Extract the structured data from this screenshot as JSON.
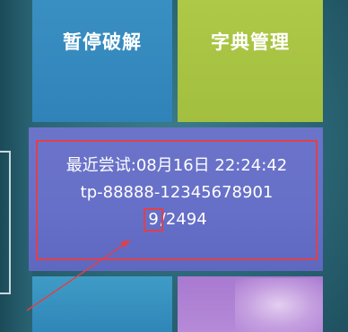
{
  "tiles": {
    "pause_crack": {
      "label": "暂停破解"
    },
    "dict_manage": {
      "label": "字典管理"
    }
  },
  "status": {
    "last_attempt": "最近尝试:08月16日 22:24:42",
    "password": "tp-88888-12345678901",
    "progress_current": "9",
    "progress_separator": "/",
    "progress_total": "2494"
  },
  "colors": {
    "tile_blue": "#3a8fc2",
    "tile_green": "#aec847",
    "tile_indigo": "#6b74c9",
    "tile_purple": "#b58ad8",
    "annotation_red": "#e0404a"
  }
}
